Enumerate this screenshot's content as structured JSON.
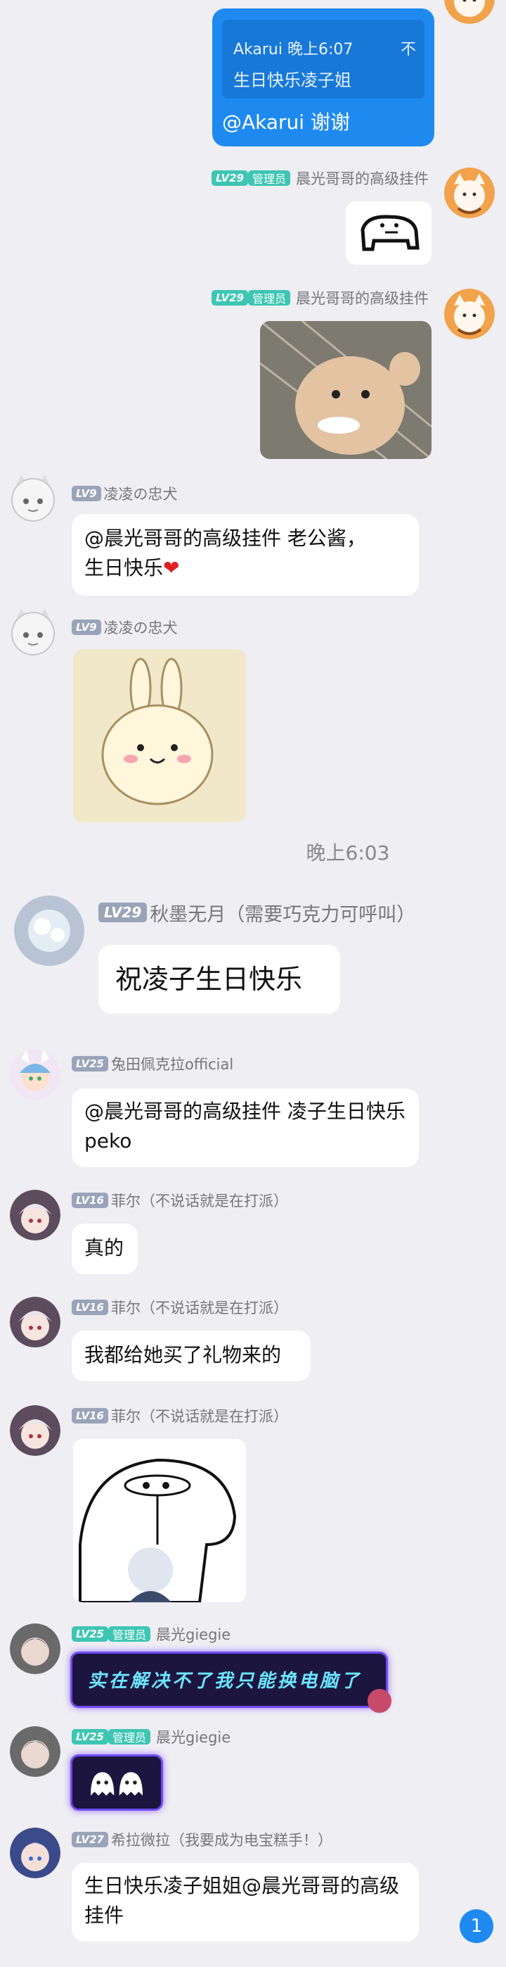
{
  "timestamp_center": "晚上6:03",
  "self_bubble": {
    "quote_header": "Akarui 晚上6:07",
    "quote_text": "生日快乐凌子姐",
    "quote_more": "不",
    "reply": "@Akarui 谢谢"
  },
  "admin_sender": {
    "level": "LV29",
    "role": "管理员",
    "name": "晨光哥哥的高级挂件"
  },
  "ling_sender": {
    "level": "LV9",
    "name": "凌凌の忠犬"
  },
  "ling_msg_1": "@晨光哥哥的高级挂件 老公酱，",
  "ling_msg_1_line2": "生日快乐",
  "ling_heart": "❤",
  "qiumo_sender": {
    "level": "LV29",
    "name": "秋墨无月（需要巧克力可呼叫）"
  },
  "qiumo_msg": "祝凌子生日快乐",
  "peko_sender": {
    "level": "LV25",
    "name": "兔田佩克拉official"
  },
  "peko_msg": "@晨光哥哥的高级挂件 凌子生日快乐peko",
  "feier_sender": {
    "level": "LV16",
    "name": "菲尔（不说话就是在打派）"
  },
  "feier_msg_1": "真的",
  "feier_msg_2": "我都给她买了礼物来的",
  "chenguang_sender": {
    "level": "LV25",
    "role": "管理员",
    "name": "晨光giegie"
  },
  "sticker_text": "实在解决不了我只能换电脑了",
  "xila_sender": {
    "level": "LV27",
    "name": "希拉微拉（我要成为电宝糕手！）"
  },
  "xila_msg": "生日快乐凌子姐姐@晨光哥哥的高级挂件",
  "unread_badge": "1",
  "colors": {
    "self_bubble": "#1e8af0",
    "badge": "#1e8af0",
    "admin_tag": "#3ec6b3",
    "level_tag": "#9aa4b8"
  }
}
